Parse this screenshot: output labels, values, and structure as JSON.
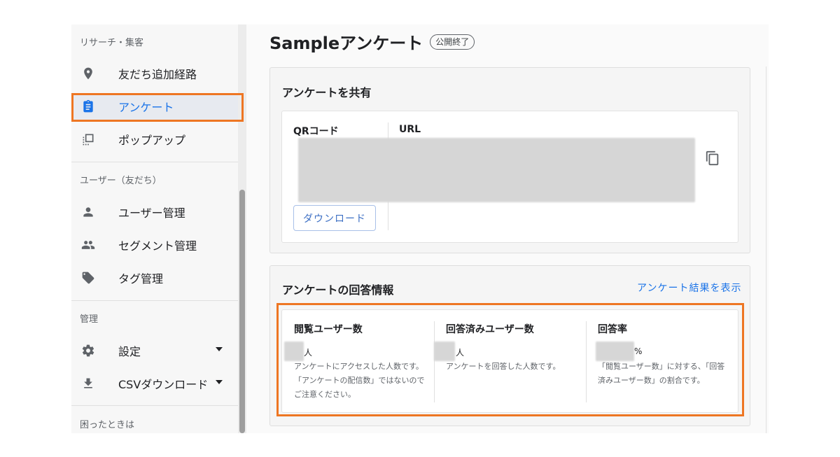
{
  "sidebar": {
    "sections": [
      {
        "label": "リサーチ・集客",
        "items": [
          {
            "label": "友だち追加経路",
            "icon": "location-pin-icon"
          },
          {
            "label": "アンケート",
            "icon": "clipboard-icon",
            "active": true
          },
          {
            "label": "ポップアップ",
            "icon": "popup-icon"
          }
        ]
      },
      {
        "label": "ユーザー（友だち）",
        "items": [
          {
            "label": "ユーザー管理",
            "icon": "person-icon"
          },
          {
            "label": "セグメント管理",
            "icon": "group-icon"
          },
          {
            "label": "タグ管理",
            "icon": "tag-icon"
          }
        ]
      },
      {
        "label": "管理",
        "items": [
          {
            "label": "設定",
            "icon": "gear-icon"
          },
          {
            "label": "CSVダウンロード",
            "icon": "download-icon"
          }
        ]
      },
      {
        "label": "困ったときは",
        "items": []
      }
    ]
  },
  "page": {
    "title": "Sampleアンケート",
    "status_badge": "公開終了"
  },
  "share_card": {
    "title": "アンケートを共有",
    "qr_label": "QRコード",
    "url_label": "URL",
    "download_button": "ダウンロード"
  },
  "answers_card": {
    "title": "アンケートの回答情報",
    "results_link": "アンケート結果を表示",
    "stats": [
      {
        "title": "閲覧ユーザー数",
        "unit": "人",
        "description": "アンケートにアクセスした人数です。「アンケートの配信数」ではないのでご注意ください。"
      },
      {
        "title": "回答済みユーザー数",
        "unit": "人",
        "description": "アンケートを回答した人数です。"
      },
      {
        "title": "回答率",
        "unit": "%",
        "description": "「閲覧ユーザー数」に対する、「回答済みユーザー数」の割合です。"
      }
    ]
  },
  "colors": {
    "highlight": "#ee7623",
    "accent": "#1a73e8"
  }
}
